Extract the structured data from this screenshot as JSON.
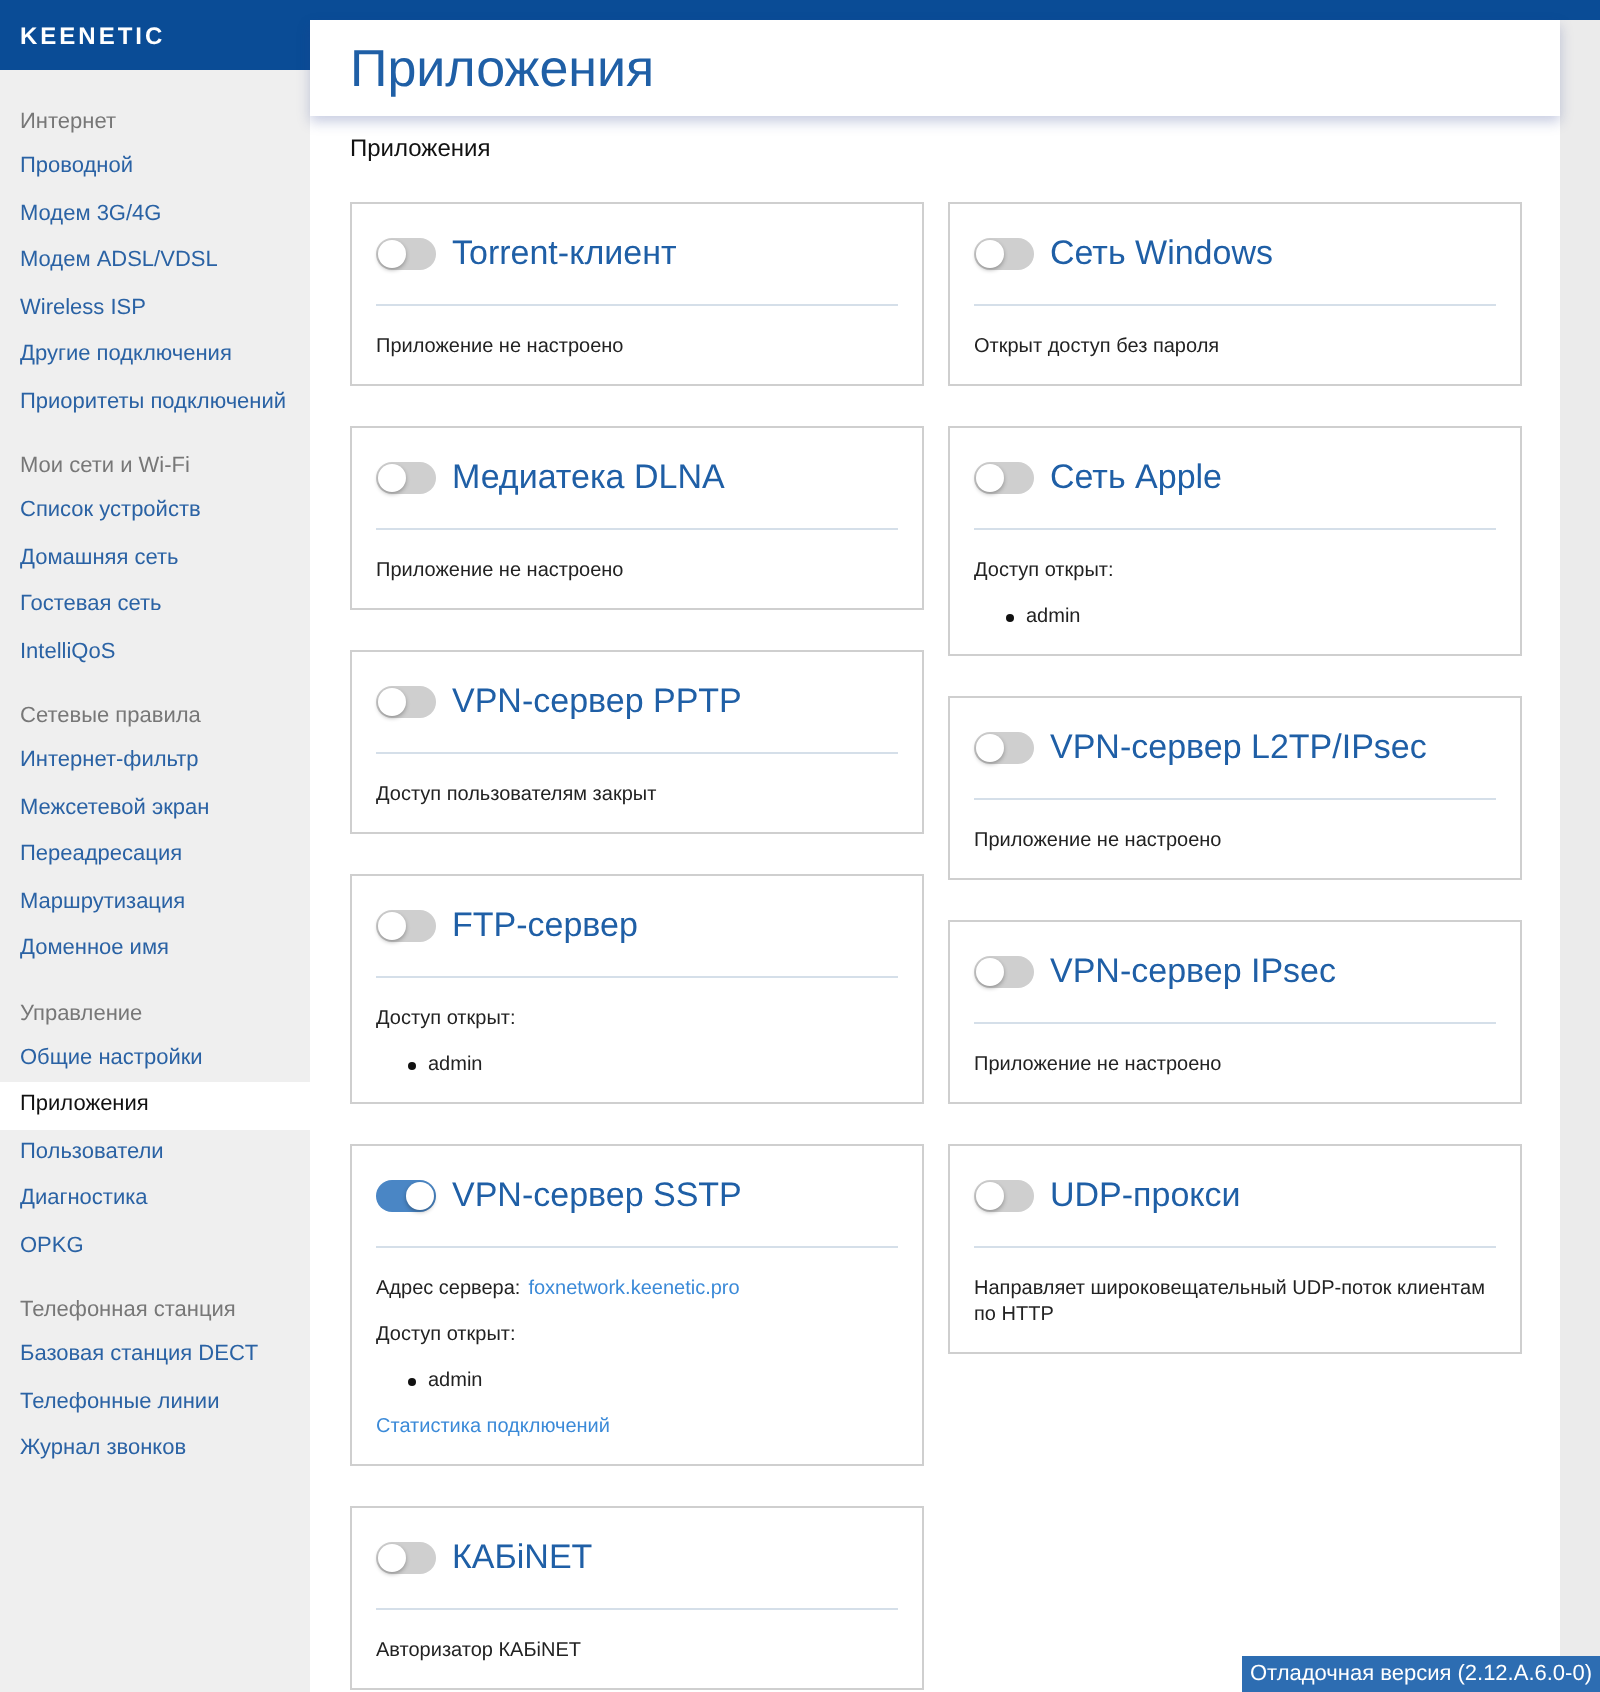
{
  "logo": "KEENETIC",
  "sidebar": {
    "groups": [
      {
        "title": "Интернет",
        "items": [
          {
            "label": "Проводной",
            "selected": false
          },
          {
            "label": "Модем 3G/4G",
            "selected": false
          },
          {
            "label": "Модем ADSL/VDSL",
            "selected": false
          },
          {
            "label": "Wireless ISP",
            "selected": false
          },
          {
            "label": "Другие подключения",
            "selected": false
          },
          {
            "label": "Приоритеты подключений",
            "selected": false
          }
        ]
      },
      {
        "title": "Мои сети и Wi-Fi",
        "items": [
          {
            "label": "Список устройств",
            "selected": false
          },
          {
            "label": "Домашняя сеть",
            "selected": false
          },
          {
            "label": "Гостевая сеть",
            "selected": false
          },
          {
            "label": "IntelliQoS",
            "selected": false
          }
        ]
      },
      {
        "title": "Сетевые правила",
        "items": [
          {
            "label": "Интернет-фильтр",
            "selected": false
          },
          {
            "label": "Межсетевой экран",
            "selected": false
          },
          {
            "label": "Переадресация",
            "selected": false
          },
          {
            "label": "Маршрутизация",
            "selected": false
          },
          {
            "label": "Доменное имя",
            "selected": false
          }
        ]
      },
      {
        "title": "Управление",
        "items": [
          {
            "label": "Общие настройки",
            "selected": false
          },
          {
            "label": "Приложения",
            "selected": true
          },
          {
            "label": "Пользователи",
            "selected": false
          },
          {
            "label": "Диагностика",
            "selected": false
          },
          {
            "label": "OPKG",
            "selected": false
          }
        ]
      },
      {
        "title": "Телефонная станция",
        "items": [
          {
            "label": "Базовая станция DECT",
            "selected": false
          },
          {
            "label": "Телефонные линии",
            "selected": false
          },
          {
            "label": "Журнал звонков",
            "selected": false
          }
        ]
      }
    ]
  },
  "page_title": "Приложения",
  "section_title": "Приложения",
  "columns": [
    [
      {
        "title": "Torrent-клиент",
        "on": false,
        "body": [
          {
            "kind": "text",
            "text": "Приложение не настроено"
          }
        ]
      },
      {
        "title": "Медиатека DLNA",
        "on": false,
        "body": [
          {
            "kind": "text",
            "text": "Приложение не настроено"
          }
        ]
      },
      {
        "title": "VPN-сервер PPTP",
        "on": false,
        "body": [
          {
            "kind": "text",
            "text": "Доступ пользователям закрыт"
          }
        ]
      },
      {
        "title": "FTP-сервер",
        "on": false,
        "body": [
          {
            "kind": "text",
            "text": "Доступ открыт:"
          },
          {
            "kind": "bullet",
            "text": "admin"
          }
        ]
      },
      {
        "title": "VPN-сервер SSTP",
        "on": true,
        "body": [
          {
            "kind": "address",
            "label": "Адрес сервера:",
            "link": "foxnetwork.keenetic.pro"
          },
          {
            "kind": "text",
            "text": "Доступ открыт:"
          },
          {
            "kind": "bullet",
            "text": "admin"
          },
          {
            "kind": "link",
            "text": "Статистика подключений"
          }
        ]
      },
      {
        "title": "КАБiNET",
        "on": false,
        "body": [
          {
            "kind": "text",
            "text": "Авторизатор КАБiNET"
          }
        ]
      }
    ],
    [
      {
        "title": "Сеть Windows",
        "on": false,
        "body": [
          {
            "kind": "text",
            "text": "Открыт доступ без пароля"
          }
        ]
      },
      {
        "title": "Сеть Apple",
        "on": false,
        "body": [
          {
            "kind": "text",
            "text": "Доступ открыт:"
          },
          {
            "kind": "bullet",
            "text": "admin"
          }
        ]
      },
      {
        "title": "VPN-сервер L2TP/IPsec",
        "on": false,
        "body": [
          {
            "kind": "text",
            "text": "Приложение не настроено"
          }
        ]
      },
      {
        "title": "VPN-сервер IPsec",
        "on": false,
        "body": [
          {
            "kind": "text",
            "text": "Приложение не настроено"
          }
        ]
      },
      {
        "title": "UDP-прокси",
        "on": false,
        "body": [
          {
            "kind": "text",
            "text": "Направляет широковещательный UDP-поток клиентам по HTTP"
          }
        ]
      }
    ]
  ],
  "version_badge": "Отладочная версия (2.12.A.6.0-0)"
}
